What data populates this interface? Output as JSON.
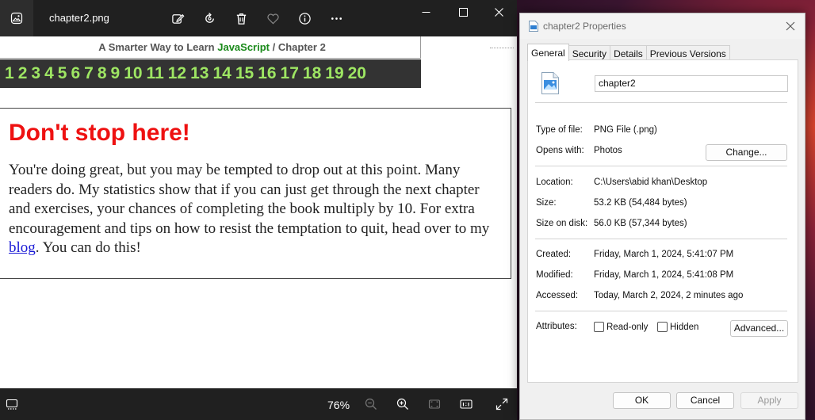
{
  "photos": {
    "title": "chapter2.png",
    "zoom": "76%"
  },
  "book": {
    "header_prefix": "A Smarter Way to Learn ",
    "header_js": "JavaScript",
    "header_suffix": " / Chapter 2",
    "chapters": [
      "1",
      "2",
      "3",
      "4",
      "5",
      "6",
      "7",
      "8",
      "9",
      "10",
      "11",
      "12",
      "13",
      "14",
      "15",
      "16",
      "17",
      "18",
      "19",
      "20"
    ],
    "title": "Don't stop here!",
    "body_before_link": "You're doing great, but you may be tempted to drop out at this point. Many readers do. My statistics show that if you can just get through the next chapter and exercises, your chances of completing the book multiply by 10. For extra encouragement and tips on how to resist the temptation to quit, head over to my ",
    "link_text": "blog",
    "body_after_link": ". You can do this!"
  },
  "props": {
    "title": "chapter2 Properties",
    "tabs": [
      "General",
      "Security",
      "Details",
      "Previous Versions"
    ],
    "file_name": "chapter2",
    "type_label": "Type of file:",
    "type_value": "PNG File (.png)",
    "opens_label": "Opens with:",
    "opens_value": "Photos",
    "change_btn": "Change...",
    "location_label": "Location:",
    "location_value": "C:\\Users\\abid khan\\Desktop",
    "size_label": "Size:",
    "size_value": "53.2 KB (54,484 bytes)",
    "disk_label": "Size on disk:",
    "disk_value": "56.0 KB (57,344 bytes)",
    "created_label": "Created:",
    "created_value": "Friday, March 1, 2024, 5:41:07 PM",
    "modified_label": "Modified:",
    "modified_value": "Friday, March 1, 2024, 5:41:08 PM",
    "accessed_label": "Accessed:",
    "accessed_value": "Today, March 2, 2024, 2 minutes ago",
    "attributes_label": "Attributes:",
    "readonly_label": "Read-only",
    "hidden_label": "Hidden",
    "advanced_btn": "Advanced...",
    "ok_btn": "OK",
    "cancel_btn": "Cancel",
    "apply_btn": "Apply"
  }
}
